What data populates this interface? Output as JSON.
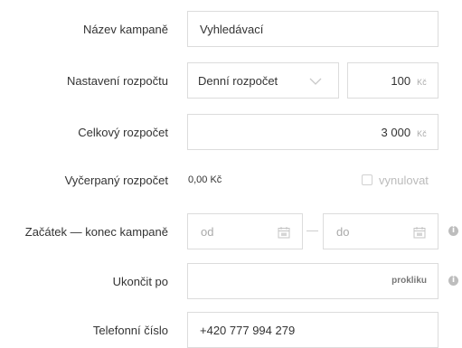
{
  "campaign_name": {
    "label": "Název kampaně",
    "value": "Vyhledávací"
  },
  "budget_setting": {
    "label": "Nastavení rozpočtu",
    "selected": "Denní rozpočet",
    "amount": "100",
    "currency": "Kč"
  },
  "total_budget": {
    "label": "Celkový rozpočet",
    "amount": "3 000",
    "currency": "Kč"
  },
  "spent_budget": {
    "label": "Vyčerpaný rozpočet",
    "value": "0,00 Kč",
    "reset_label": "vynulovat"
  },
  "campaign_dates": {
    "label": "Začátek — konec kampaně",
    "from_placeholder": "od",
    "to_placeholder": "do",
    "separator": "—"
  },
  "end_after": {
    "label": "Ukončit po",
    "unit": "prokliku"
  },
  "phone": {
    "label": "Telefonní číslo",
    "value": "+420 777 994 279"
  }
}
